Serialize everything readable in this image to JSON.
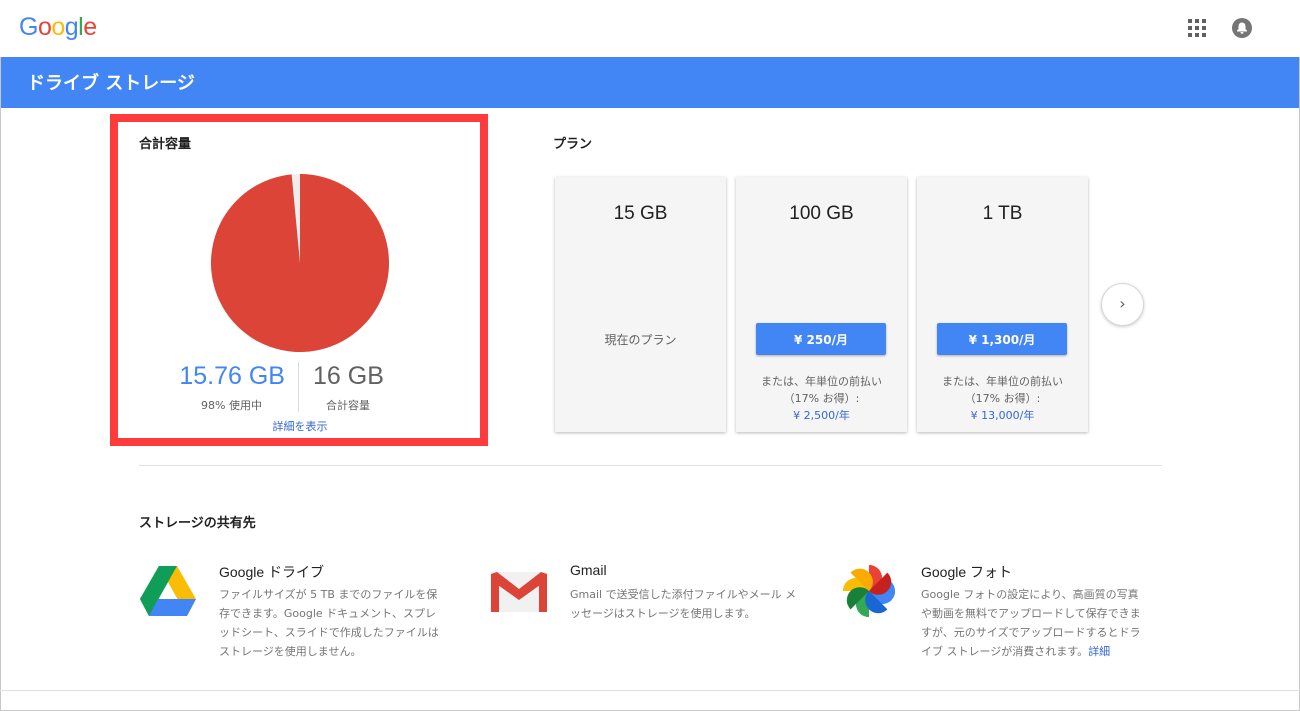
{
  "header": {
    "logo_letters": [
      "G",
      "o",
      "o",
      "g",
      "l",
      "e"
    ],
    "logo_colors": [
      "#4285f4",
      "#ea4335",
      "#fbbc05",
      "#4285f4",
      "#34a853",
      "#ea4335"
    ],
    "apps_icon": "apps-grid-icon",
    "account_icon": "account-circle-icon"
  },
  "title_bar": {
    "title": "ドライブ ストレージ",
    "color": "#4285f4"
  },
  "total_storage": {
    "heading": "合計容量",
    "used": "15.76 GB",
    "used_sub": "98% 使用中",
    "used_fraction": 0.985,
    "total": "16 GB",
    "total_sub": "合計容量",
    "details_link": "詳細を表示",
    "pie_used_color": "#db4437",
    "pie_free_color": "#eeeeee"
  },
  "plans": {
    "heading": "プラン",
    "cards": [
      {
        "size": "15 GB",
        "current_label": "現在のプラン"
      },
      {
        "size": "100 GB",
        "price": "¥ 250/月",
        "annual_note": "または、年単位の前払い（17% お得）:",
        "annual_price": "¥ 2,500/年"
      },
      {
        "size": "1 TB",
        "price": "¥ 1,300/月",
        "annual_note": "または、年単位の前払い（17% お得）:",
        "annual_price": "¥ 13,000/年"
      }
    ],
    "next_icon": "chevron-right-icon",
    "next_glyph": "›"
  },
  "shared": {
    "heading": "ストレージの共有先",
    "services": [
      {
        "icon": "google-drive-icon",
        "name": "Google ドライブ",
        "desc": "ファイルサイズが 5 TB までのファイルを保\n存できます。Google ドキュメント、スプレ\nッドシート、スライドで作成したファイルは\nストレージを使用しません。"
      },
      {
        "icon": "gmail-icon",
        "name": "Gmail",
        "desc": "Gmail で送受信した添付ファイルやメール メ\nッセージはストレージを使用します。"
      },
      {
        "icon": "google-photos-icon",
        "name": "Google フォト",
        "desc": "Google フォトの設定により、高画質の写真\nや動画を無料でアップロードして保存できま\nすが、元のサイズでアップロードするとドラ\nイブ ストレージが消費されます。",
        "link": "詳細"
      }
    ]
  }
}
